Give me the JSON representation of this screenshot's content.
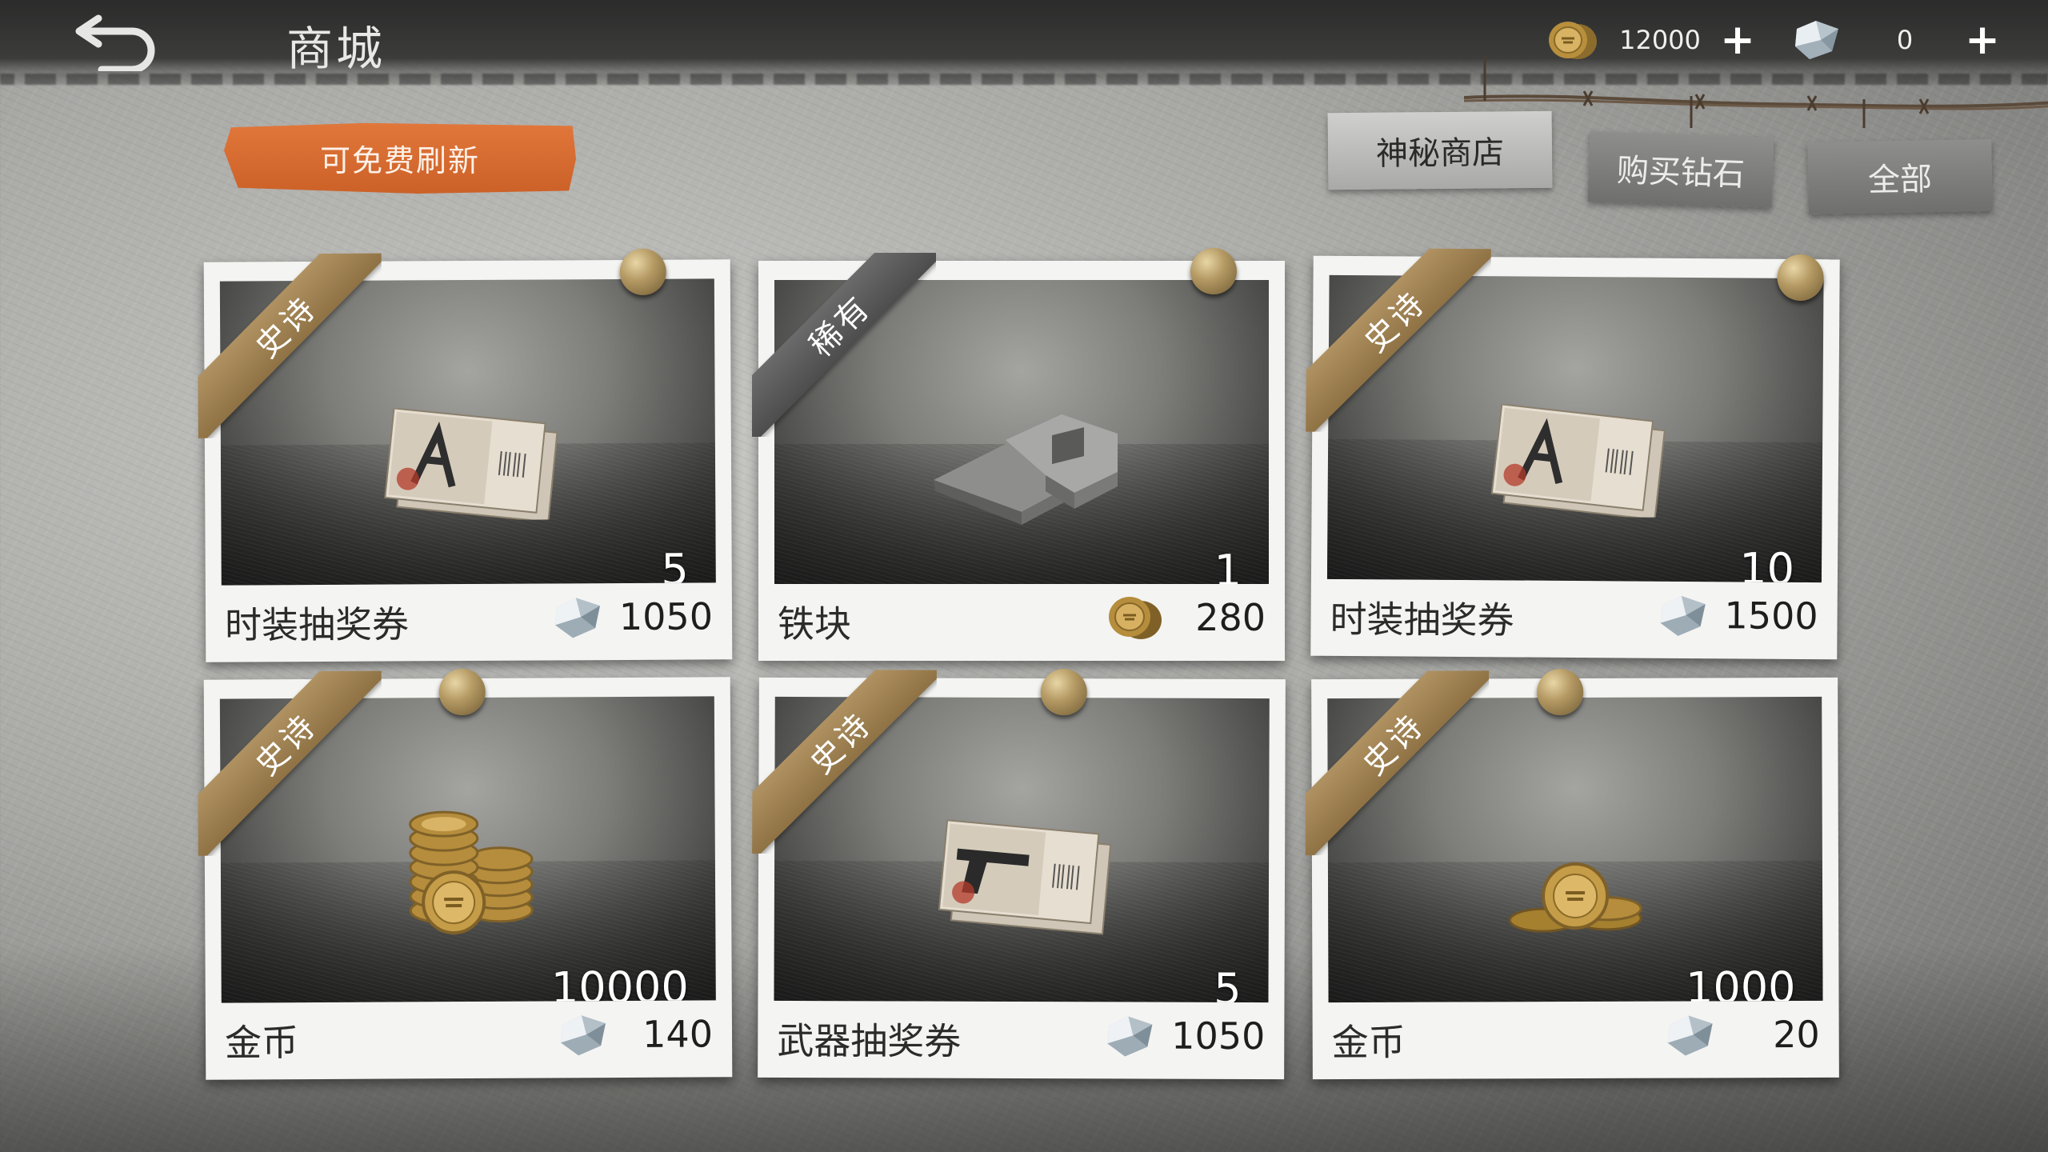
{
  "header": {
    "title": "商城",
    "gold_amount": "12000",
    "diamond_amount": "0",
    "plus_label": "+"
  },
  "refresh": {
    "label": "可免费刷新"
  },
  "tabs": [
    {
      "label": "神秘商店",
      "active": true
    },
    {
      "label": "购买钻石",
      "active": false
    },
    {
      "label": "全部",
      "active": false
    }
  ],
  "products": [
    {
      "rarity": "史诗",
      "name": "时装抽奖券",
      "qty": "5",
      "price": "1050",
      "currency": "diamond",
      "icon": "costume-ticket-icon"
    },
    {
      "rarity": "稀有",
      "name": "铁块",
      "qty": "1",
      "price": "280",
      "currency": "gold",
      "icon": "iron-block-icon"
    },
    {
      "rarity": "史诗",
      "name": "时装抽奖券",
      "qty": "10",
      "price": "1500",
      "currency": "diamond",
      "icon": "costume-ticket-icon"
    },
    {
      "rarity": "史诗",
      "name": "金币",
      "qty": "10000",
      "price": "140",
      "currency": "diamond",
      "icon": "gold-coin-stack-icon"
    },
    {
      "rarity": "史诗",
      "name": "武器抽奖券",
      "qty": "5",
      "price": "1050",
      "currency": "diamond",
      "icon": "weapon-ticket-icon"
    },
    {
      "rarity": "史诗",
      "name": "金币",
      "qty": "1000",
      "price": "20",
      "currency": "diamond",
      "icon": "gold-coin-pile-icon"
    }
  ],
  "colors": {
    "epic_ribbon": "#a08455",
    "rare_ribbon": "#5c5c5c",
    "refresh_button": "#d96a2f"
  }
}
